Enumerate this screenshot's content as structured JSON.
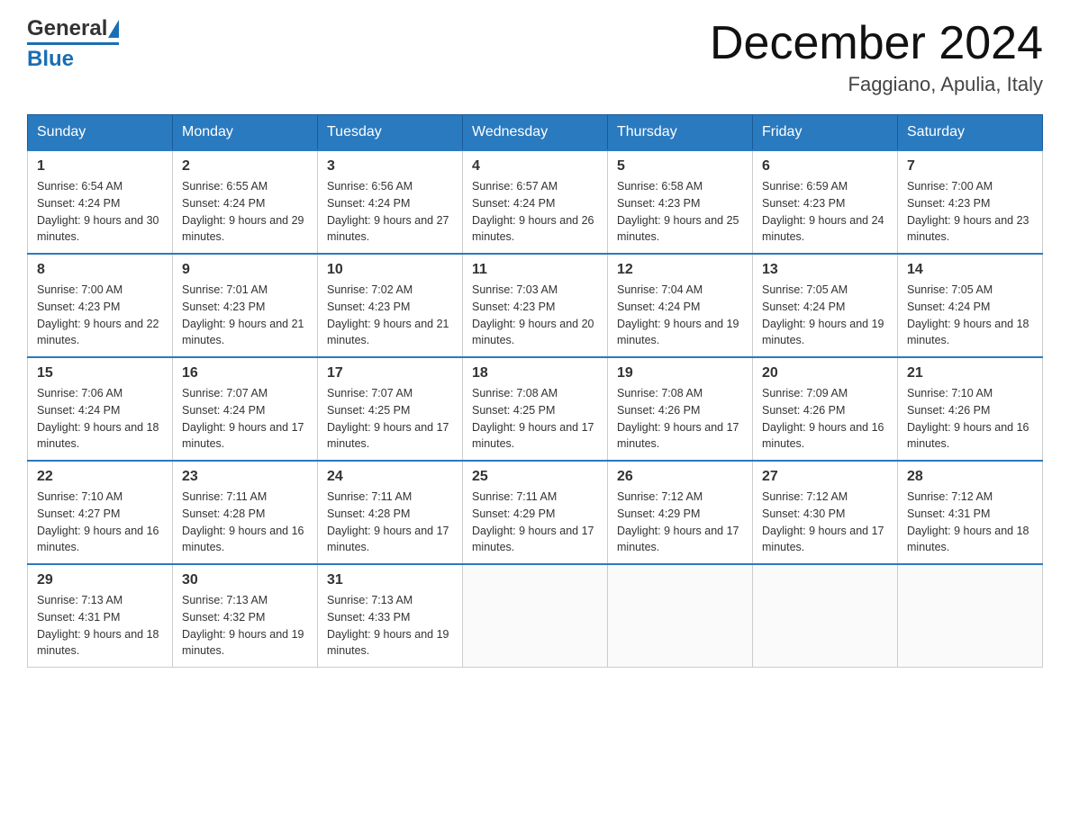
{
  "header": {
    "logo_general": "General",
    "logo_blue": "Blue",
    "title": "December 2024",
    "subtitle": "Faggiano, Apulia, Italy"
  },
  "days_of_week": [
    "Sunday",
    "Monday",
    "Tuesday",
    "Wednesday",
    "Thursday",
    "Friday",
    "Saturday"
  ],
  "weeks": [
    [
      {
        "num": "1",
        "sunrise": "6:54 AM",
        "sunset": "4:24 PM",
        "daylight": "9 hours and 30 minutes."
      },
      {
        "num": "2",
        "sunrise": "6:55 AM",
        "sunset": "4:24 PM",
        "daylight": "9 hours and 29 minutes."
      },
      {
        "num": "3",
        "sunrise": "6:56 AM",
        "sunset": "4:24 PM",
        "daylight": "9 hours and 27 minutes."
      },
      {
        "num": "4",
        "sunrise": "6:57 AM",
        "sunset": "4:24 PM",
        "daylight": "9 hours and 26 minutes."
      },
      {
        "num": "5",
        "sunrise": "6:58 AM",
        "sunset": "4:23 PM",
        "daylight": "9 hours and 25 minutes."
      },
      {
        "num": "6",
        "sunrise": "6:59 AM",
        "sunset": "4:23 PM",
        "daylight": "9 hours and 24 minutes."
      },
      {
        "num": "7",
        "sunrise": "7:00 AM",
        "sunset": "4:23 PM",
        "daylight": "9 hours and 23 minutes."
      }
    ],
    [
      {
        "num": "8",
        "sunrise": "7:00 AM",
        "sunset": "4:23 PM",
        "daylight": "9 hours and 22 minutes."
      },
      {
        "num": "9",
        "sunrise": "7:01 AM",
        "sunset": "4:23 PM",
        "daylight": "9 hours and 21 minutes."
      },
      {
        "num": "10",
        "sunrise": "7:02 AM",
        "sunset": "4:23 PM",
        "daylight": "9 hours and 21 minutes."
      },
      {
        "num": "11",
        "sunrise": "7:03 AM",
        "sunset": "4:23 PM",
        "daylight": "9 hours and 20 minutes."
      },
      {
        "num": "12",
        "sunrise": "7:04 AM",
        "sunset": "4:24 PM",
        "daylight": "9 hours and 19 minutes."
      },
      {
        "num": "13",
        "sunrise": "7:05 AM",
        "sunset": "4:24 PM",
        "daylight": "9 hours and 19 minutes."
      },
      {
        "num": "14",
        "sunrise": "7:05 AM",
        "sunset": "4:24 PM",
        "daylight": "9 hours and 18 minutes."
      }
    ],
    [
      {
        "num": "15",
        "sunrise": "7:06 AM",
        "sunset": "4:24 PM",
        "daylight": "9 hours and 18 minutes."
      },
      {
        "num": "16",
        "sunrise": "7:07 AM",
        "sunset": "4:24 PM",
        "daylight": "9 hours and 17 minutes."
      },
      {
        "num": "17",
        "sunrise": "7:07 AM",
        "sunset": "4:25 PM",
        "daylight": "9 hours and 17 minutes."
      },
      {
        "num": "18",
        "sunrise": "7:08 AM",
        "sunset": "4:25 PM",
        "daylight": "9 hours and 17 minutes."
      },
      {
        "num": "19",
        "sunrise": "7:08 AM",
        "sunset": "4:26 PM",
        "daylight": "9 hours and 17 minutes."
      },
      {
        "num": "20",
        "sunrise": "7:09 AM",
        "sunset": "4:26 PM",
        "daylight": "9 hours and 16 minutes."
      },
      {
        "num": "21",
        "sunrise": "7:10 AM",
        "sunset": "4:26 PM",
        "daylight": "9 hours and 16 minutes."
      }
    ],
    [
      {
        "num": "22",
        "sunrise": "7:10 AM",
        "sunset": "4:27 PM",
        "daylight": "9 hours and 16 minutes."
      },
      {
        "num": "23",
        "sunrise": "7:11 AM",
        "sunset": "4:28 PM",
        "daylight": "9 hours and 16 minutes."
      },
      {
        "num": "24",
        "sunrise": "7:11 AM",
        "sunset": "4:28 PM",
        "daylight": "9 hours and 17 minutes."
      },
      {
        "num": "25",
        "sunrise": "7:11 AM",
        "sunset": "4:29 PM",
        "daylight": "9 hours and 17 minutes."
      },
      {
        "num": "26",
        "sunrise": "7:12 AM",
        "sunset": "4:29 PM",
        "daylight": "9 hours and 17 minutes."
      },
      {
        "num": "27",
        "sunrise": "7:12 AM",
        "sunset": "4:30 PM",
        "daylight": "9 hours and 17 minutes."
      },
      {
        "num": "28",
        "sunrise": "7:12 AM",
        "sunset": "4:31 PM",
        "daylight": "9 hours and 18 minutes."
      }
    ],
    [
      {
        "num": "29",
        "sunrise": "7:13 AM",
        "sunset": "4:31 PM",
        "daylight": "9 hours and 18 minutes."
      },
      {
        "num": "30",
        "sunrise": "7:13 AM",
        "sunset": "4:32 PM",
        "daylight": "9 hours and 19 minutes."
      },
      {
        "num": "31",
        "sunrise": "7:13 AM",
        "sunset": "4:33 PM",
        "daylight": "9 hours and 19 minutes."
      },
      null,
      null,
      null,
      null
    ]
  ],
  "labels": {
    "sunrise": "Sunrise:",
    "sunset": "Sunset:",
    "daylight": "Daylight:"
  }
}
